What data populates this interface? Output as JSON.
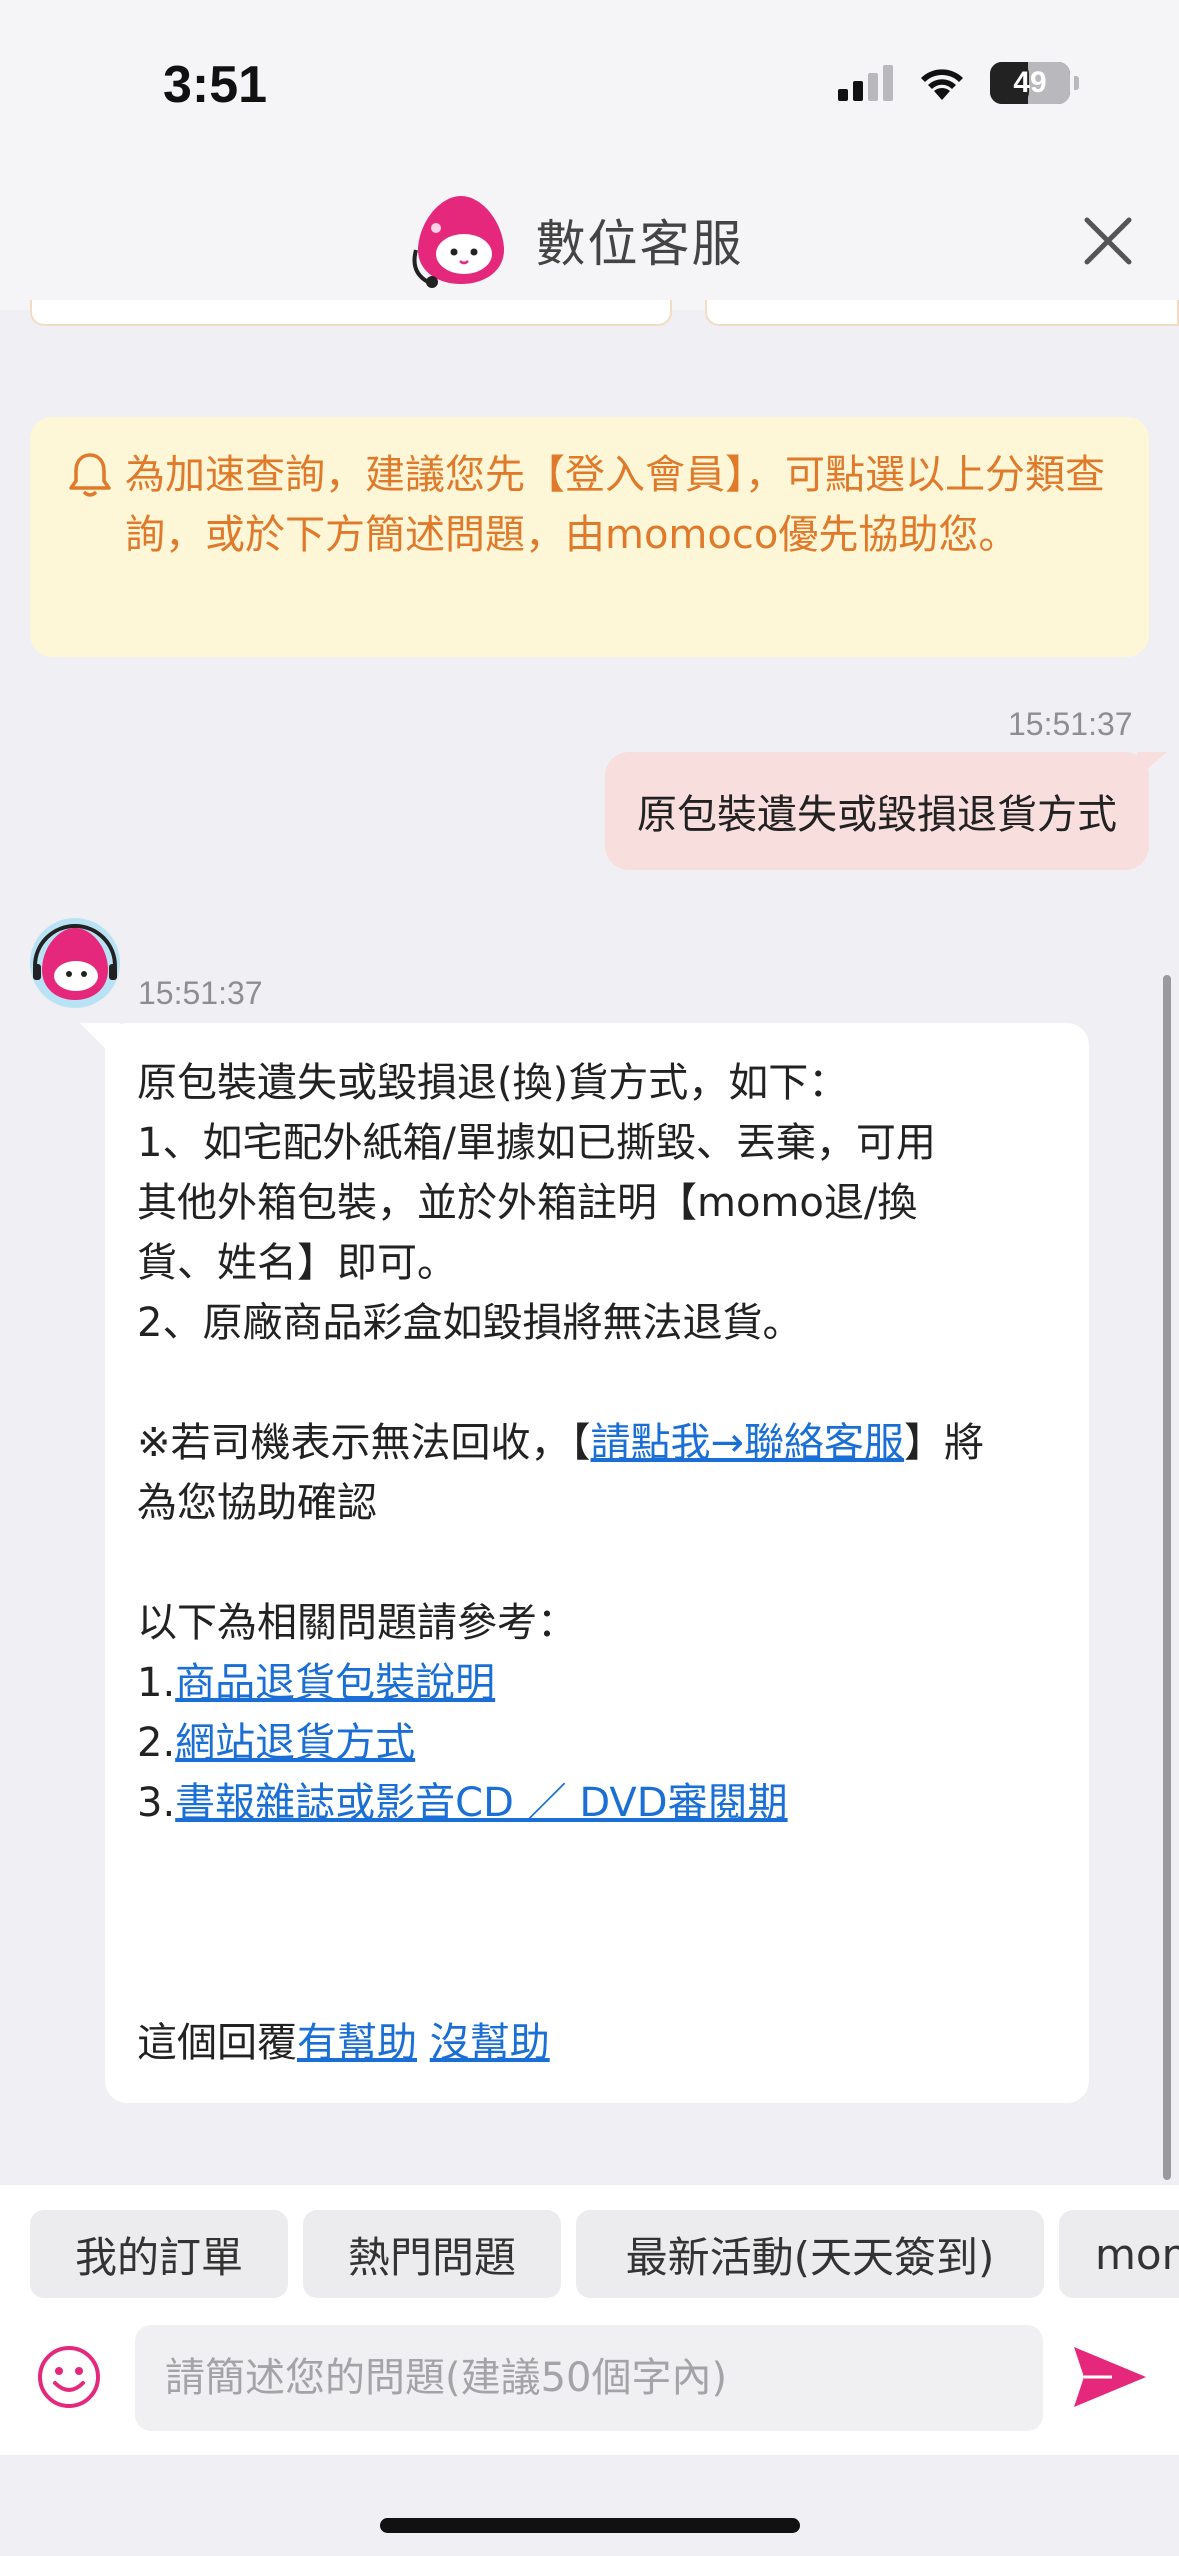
{
  "status_bar": {
    "time": "3:51",
    "battery": "49"
  },
  "header": {
    "title": "數位客服"
  },
  "notice": {
    "text": "為加速查詢，建議您先【登入會員】，可點選以上分類查詢，或於下方簡述問題，由momoco優先協助您。"
  },
  "user_message": {
    "timestamp": "15:51:37",
    "text": "原包裝遺失或毀損退貨方式"
  },
  "bot_message": {
    "timestamp": "15:51:37",
    "line1": "原包裝遺失或毀損退(換)貨方式，如下：",
    "line2": "1、如宅配外紙箱/單據如已撕毀、丟棄，可用",
    "line3": "其他外箱包裝，並於外箱註明【momo退/換",
    "line4": "貨、姓名】即可。",
    "line5": "2、原廠商品彩盒如毀損將無法退貨。",
    "note_prefix": "※若司機表示無法回收，【",
    "note_link": "請點我→聯絡客服",
    "note_suffix": "】將為您協助確認",
    "refs_title": "以下為相關問題請參考：",
    "refs": [
      {
        "num": "1.",
        "label": "商品退貨包裝說明"
      },
      {
        "num": "2.",
        "label": "網站退貨方式"
      },
      {
        "num": "3.",
        "label": "書報雜誌或影音CD ／ DVD審閱期"
      }
    ],
    "feedback_prefix": "這個回覆",
    "helpful": "有幫助",
    "not_helpful": "沒幫助"
  },
  "quick_replies": [
    "我的訂單",
    "熱門問題",
    "最新活動(天天簽到)",
    "momo"
  ],
  "input": {
    "placeholder": "請簡述您的問題(建議50個字內)",
    "value": ""
  },
  "colors": {
    "accent": "#e6287d",
    "notice_bg": "#fdf7d8",
    "notice_text": "#e07a2a",
    "link": "#1a6fd6",
    "user_bubble": "#f9dede"
  }
}
